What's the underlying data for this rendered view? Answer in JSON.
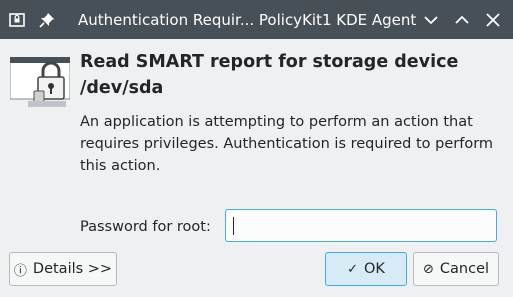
{
  "window": {
    "title": "Authentication Requir... PolicyKit1 KDE Agent",
    "app_icon": "lock-screen-icon",
    "pin_icon": "pin-icon",
    "controls": [
      "chevron-down-icon",
      "chevron-up-icon",
      "close-icon"
    ]
  },
  "dialog": {
    "icon": "system-lock-icon",
    "heading": "Read SMART report for storage device /dev/sda",
    "description": "An application is attempting to perform an action that requires privileges. Authentication is required to perform this action.",
    "password_label": "Password for root:",
    "password_value": ""
  },
  "buttons": {
    "details": "Details >>",
    "details_icon": "info-icon",
    "ok": "OK",
    "ok_icon": "checkmark-icon",
    "cancel": "Cancel",
    "cancel_icon": "cancel-icon"
  },
  "colors": {
    "titlebar": "#475057",
    "accent": "#3daee9",
    "background": "#eff0f1"
  }
}
